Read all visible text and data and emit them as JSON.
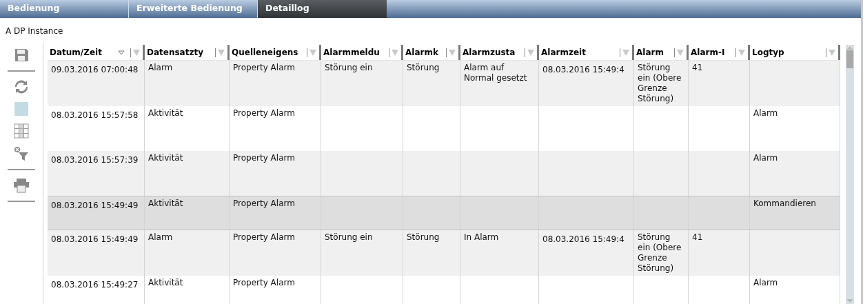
{
  "tabs": [
    {
      "label": "Bedienung",
      "selected": false
    },
    {
      "label": "Erweiterte Bedienung",
      "selected": false
    },
    {
      "label": "Detaillog",
      "selected": true
    }
  ],
  "object_title": "A DP Instance",
  "toolbar": [
    {
      "kind": "save"
    },
    {
      "kind": "divider"
    },
    {
      "kind": "refresh"
    },
    {
      "kind": "square"
    },
    {
      "kind": "grid"
    },
    {
      "kind": "clear-filter"
    },
    {
      "kind": "divider"
    },
    {
      "kind": "print"
    },
    {
      "kind": "divider"
    }
  ],
  "table": {
    "columns": [
      {
        "label": "Datum/Zeit",
        "sorted": true
      },
      {
        "label": "Datensatzty",
        "sorted": false
      },
      {
        "label": "Quelleneigens",
        "sorted": false
      },
      {
        "label": "Alarmmeldu",
        "sorted": false
      },
      {
        "label": "Alarmk",
        "sorted": false
      },
      {
        "label": "Alarmzusta",
        "sorted": false
      },
      {
        "label": "Alarmzeit",
        "sorted": false
      },
      {
        "label": "Alarm",
        "sorted": false
      },
      {
        "label": "Alarm-I",
        "sorted": false
      },
      {
        "label": "Logtyp",
        "sorted": false
      }
    ],
    "rows": [
      {
        "selected": false,
        "cells": [
          "09.03.2016 07:00:48",
          "Alarm",
          "Property Alarm",
          "Störung ein",
          "Störung",
          "Alarm auf Normal gesetzt",
          "08.03.2016 15:49:4",
          "Störung ein (Obere Grenze Störung)",
          "41",
          null
        ]
      },
      {
        "selected": false,
        "cells": [
          "08.03.2016 15:57:58",
          "Aktivität",
          "Property Alarm",
          null,
          null,
          null,
          null,
          null,
          null,
          "Alarm"
        ]
      },
      {
        "selected": false,
        "cells": [
          "08.03.2016 15:57:39",
          "Aktivität",
          "Property Alarm",
          null,
          null,
          null,
          null,
          null,
          null,
          "Alarm"
        ]
      },
      {
        "selected": true,
        "cells": [
          "08.03.2016 15:49:49",
          "Aktivität",
          "Property Alarm",
          null,
          null,
          null,
          null,
          null,
          null,
          "Kommandieren"
        ]
      },
      {
        "selected": false,
        "cells": [
          "08.03.2016 15:49:49",
          "Alarm",
          "Property Alarm",
          "Störung ein",
          "Störung",
          "In Alarm",
          "08.03.2016 15:49:4",
          "Störung ein (Obere Grenze Störung)",
          "41",
          null
        ]
      },
      {
        "selected": false,
        "cells": [
          "08.03.2016 15:49:27",
          "Aktivität",
          "Property Alarm",
          null,
          null,
          null,
          null,
          null,
          null,
          "Alarm"
        ]
      }
    ]
  }
}
